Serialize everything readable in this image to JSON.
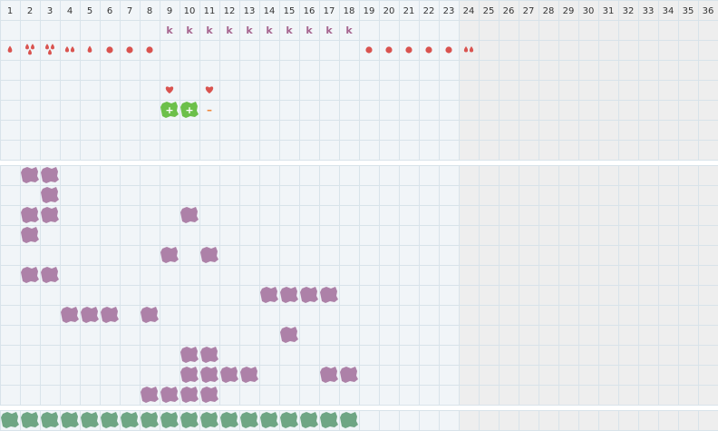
{
  "days": [
    "1",
    "2",
    "3",
    "4",
    "5",
    "6",
    "7",
    "8",
    "9",
    "10",
    "11",
    "12",
    "13",
    "14",
    "15",
    "16",
    "17",
    "18",
    "19",
    "20",
    "21",
    "22",
    "23",
    "24",
    "25",
    "26",
    "27",
    "28",
    "29",
    "30",
    "31",
    "32",
    "33",
    "34",
    "35",
    "36"
  ],
  "inactive_from_day": 24,
  "colors": {
    "background": "#f1f5f8",
    "inactive_background": "#eeeeee",
    "grid": "#d8e3ea",
    "header_text": "#333333",
    "bleeding": "#d9534f",
    "mood_letter": "#a6658f",
    "heart": "#d9534f",
    "test_positive": "#6cc04a",
    "test_negative": "#f0883c",
    "symptom_purple": "#ad81a8",
    "day_green": "#6fa684"
  },
  "letter_marker": "k",
  "test_labels": {
    "positive": "+",
    "negative": "–"
  },
  "tracking": {
    "bleeding": [
      {
        "day": 1,
        "level": "1"
      },
      {
        "day": 2,
        "level": "3"
      },
      {
        "day": 3,
        "level": "3"
      },
      {
        "day": 4,
        "level": "2"
      },
      {
        "day": 5,
        "level": "1"
      },
      {
        "day": 6,
        "level": "spot"
      },
      {
        "day": 7,
        "level": "spot"
      },
      {
        "day": 8,
        "level": "spot"
      },
      {
        "day": 19,
        "level": "spot"
      },
      {
        "day": 20,
        "level": "spot"
      },
      {
        "day": 21,
        "level": "spot"
      },
      {
        "day": 22,
        "level": "spot"
      },
      {
        "day": 23,
        "level": "spot"
      },
      {
        "day": 24,
        "level": "2"
      }
    ],
    "letters_days": [
      9,
      10,
      11,
      12,
      13,
      14,
      15,
      16,
      17,
      18
    ],
    "hearts_days": [
      9,
      11
    ],
    "tests": [
      {
        "day": 9,
        "result": "positive"
      },
      {
        "day": 10,
        "result": "positive"
      },
      {
        "day": 11,
        "result": "negative"
      }
    ],
    "symptom_rows": [
      [
        2,
        3
      ],
      [
        3
      ],
      [
        2,
        3,
        10
      ],
      [
        2
      ],
      [
        9,
        11
      ],
      [
        2,
        3
      ],
      [
        14,
        15,
        16,
        17
      ],
      [
        4,
        5,
        6,
        8
      ],
      [
        15
      ],
      [
        10,
        11
      ],
      [
        10,
        11,
        12,
        13,
        17,
        18
      ],
      [
        8,
        9,
        10,
        11
      ]
    ],
    "bottom_row_days": [
      1,
      2,
      3,
      4,
      5,
      6,
      7,
      8,
      9,
      10,
      11,
      12,
      13,
      14,
      15,
      16,
      17,
      18
    ]
  }
}
